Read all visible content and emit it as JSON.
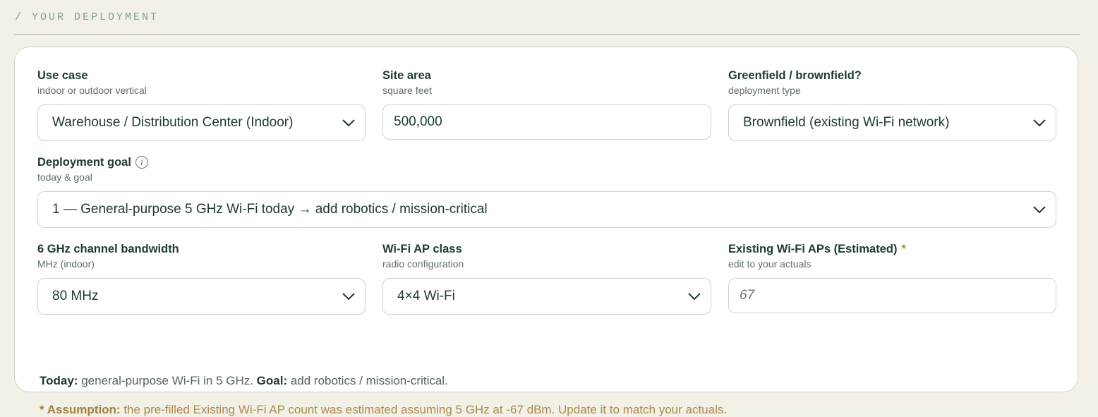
{
  "section": {
    "heading": "/ YOUR DEPLOYMENT"
  },
  "fields": {
    "use_case": {
      "label": "Use case",
      "sublabel": "indoor or outdoor vertical",
      "value": "Warehouse / Distribution Center (Indoor)"
    },
    "site_area": {
      "label": "Site area",
      "sublabel": "square feet",
      "value": "500,000"
    },
    "greenfield": {
      "label": "Greenfield / brownfield?",
      "sublabel": "deployment type",
      "value": "Brownfield (existing Wi-Fi network)"
    },
    "deployment_goal": {
      "label": "Deployment goal",
      "sublabel": "today & goal",
      "value": "1 — General-purpose 5 GHz Wi-Fi today → add robotics / mission-critical",
      "info_icon": "info-icon"
    },
    "channel_bandwidth": {
      "label": "6 GHz channel bandwidth",
      "sublabel": "MHz (indoor)",
      "value": "80 MHz"
    },
    "ap_class": {
      "label": "Wi-Fi AP class",
      "sublabel": "radio configuration",
      "value": "4×4 Wi-Fi"
    },
    "existing_aps": {
      "label": "Existing Wi-Fi APs (Estimated)",
      "required_mark": "*",
      "sublabel": "edit to your actuals",
      "placeholder": "67"
    }
  },
  "summary": {
    "today_label": "Today:",
    "today_text": " general-purpose Wi-Fi in 5 GHz. ",
    "goal_label": "Goal:",
    "goal_text": " add robotics / mission-critical."
  },
  "assumption": {
    "label": "* Assumption:",
    "text": " the pre-filled Existing Wi-Fi AP count was estimated assuming 5 GHz at -67 dBm. Update it to match your actuals."
  },
  "colors": {
    "background": "#f3f0e6",
    "text_primary": "#1e3a2e",
    "accent_gold": "#a98a52",
    "heading_green": "#7aa68a"
  }
}
